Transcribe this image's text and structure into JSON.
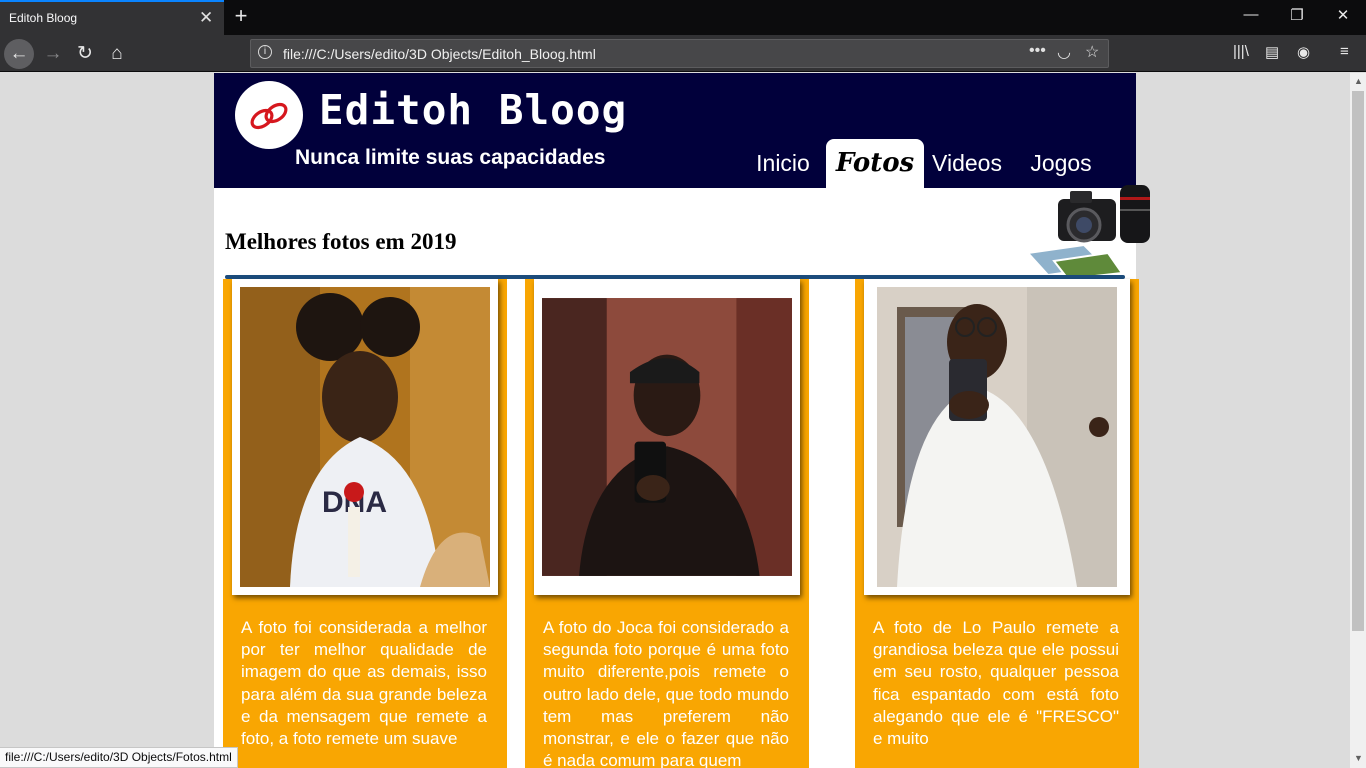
{
  "browser": {
    "tab_title": "Editoh Bloog",
    "url": "file:///C:/Users/edito/3D Objects/Editoh_Bloog.html",
    "status_url": "file:///C:/Users/edito/3D Objects/Fotos.html"
  },
  "site": {
    "brand": "Editoh Bloog",
    "slogan": "Nunca limite suas capacidades",
    "nav": [
      {
        "label": "Inicio",
        "active": false
      },
      {
        "label": "Fotos",
        "active": true
      },
      {
        "label": "Videos",
        "active": false
      },
      {
        "label": "Jogos",
        "active": false
      }
    ],
    "section_title": "Melhores fotos em 2019",
    "cards": [
      {
        "text": "A foto foi considerada a melhor por ter melhor qualidade de imagem do que as demais, isso para além da sua grande beleza e da mensagem que remete a foto, a foto remete um suave"
      },
      {
        "text": "A foto do Joca foi considerado a segunda foto porque é uma foto muito diferente,pois remete o outro lado dele, que todo mundo tem mas preferem não monstrar, e ele o fazer que não é nada comum para quem"
      },
      {
        "text": "A foto de Lo Paulo remete a grandiosa beleza que ele possui em seu rosto, qualquer pessoa fica espantado com está foto alegando que ele é \"FRESCO\" e muito"
      }
    ]
  },
  "colors": {
    "header_bg": "#01003b",
    "card_bg": "#f9a602",
    "rule": "#1c4c7c"
  }
}
